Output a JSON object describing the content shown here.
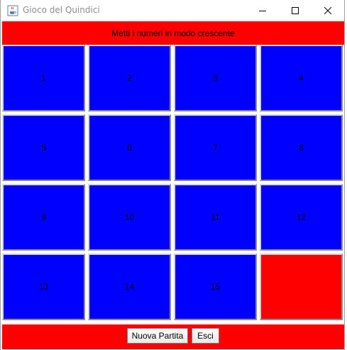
{
  "window": {
    "title": "Gioco del Quindici",
    "icon": "java-cup-icon"
  },
  "header": {
    "message": "Metti i numeri in modo crescente"
  },
  "board": {
    "tiles": [
      "1",
      "2",
      "3",
      "4",
      "5",
      "6",
      "7",
      "8",
      "9",
      "10",
      "11",
      "12",
      "13",
      "14",
      "15",
      ""
    ],
    "tile_color": "#0000ff",
    "empty_color": "#ff0000"
  },
  "footer": {
    "new_game_label": "Nuova Partita",
    "exit_label": "Esci"
  },
  "colors": {
    "accent": "#ff0000",
    "tile": "#0000ff"
  }
}
